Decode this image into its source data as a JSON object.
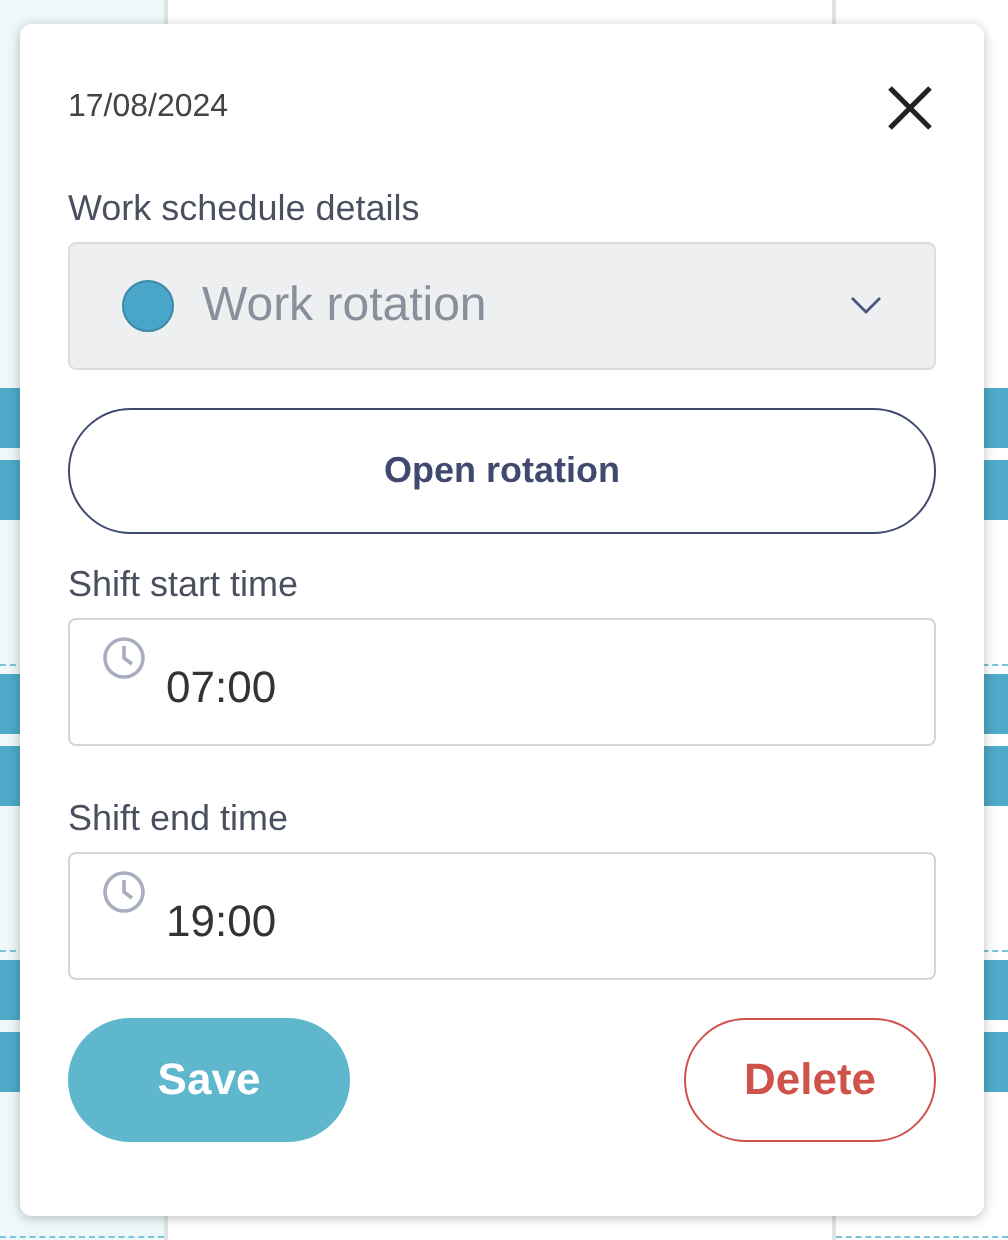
{
  "calendar": {
    "slots": [
      {
        "kind": "shift"
      },
      {
        "kind": "shift"
      },
      {
        "kind": "shift"
      }
    ]
  },
  "popup": {
    "date": "17/08/2024",
    "schedule": {
      "label": "Work schedule details",
      "value": "Work rotation",
      "color": "#4aa6c8",
      "disabled": true
    },
    "open_button": "Open rotation",
    "fields": [
      {
        "label": "Shift start time",
        "value": "07:00"
      },
      {
        "label": "Shift end time",
        "value": "19:00"
      }
    ],
    "save_button": "Save",
    "delete_button": "Delete"
  }
}
